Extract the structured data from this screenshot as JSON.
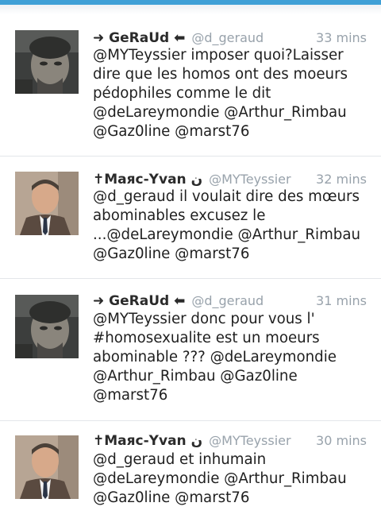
{
  "users": {
    "geraud": {
      "display_name": "➜ GeRaUd ⬅",
      "handle": "@d_geraud",
      "avatar_icon": "dark-selfie-avatar"
    },
    "yvan": {
      "display_name": "✝Маяс-Yvan ن",
      "handle": "@MYTeyssier",
      "avatar_icon": "man-in-suit-avatar"
    }
  },
  "tweets": [
    {
      "display_name": "➜ GeRaUd ⬅",
      "handle": "@d_geraud",
      "time": "33 mins",
      "lines": [
        "@MYTeyssier imposer quoi?Laisser",
        "dire que les homos ont des moeurs",
        "pédophiles comme le dit",
        "@deLareymondie @Arthur_Rimbau",
        "@Gaz0line @marst76"
      ]
    },
    {
      "display_name": "✝Маяс-Yvan ن",
      "handle": "@MYTeyssier",
      "time": "32 mins",
      "lines": [
        "@d_geraud il voulait dire des mœurs",
        "abominables excusez le",
        "...@deLareymondie @Arthur_Rimbau",
        "@Gaz0line @marst76"
      ]
    },
    {
      "display_name": "➜ GeRaUd ⬅",
      "handle": "@d_geraud",
      "time": "31 mins",
      "lines": [
        "@MYTeyssier donc pour vous l'",
        "#homosexualite est un moeurs",
        "abominable ??? @deLareymondie",
        "@Arthur_Rimbau @Gaz0line",
        "@marst76"
      ]
    },
    {
      "display_name": "✝Маяс-Yvan ن",
      "handle": "@MYTeyssier",
      "time": "30 mins",
      "lines": [
        "@d_geraud et inhumain",
        "@deLareymondie @Arthur_Rimbau",
        "@Gaz0line @marst76"
      ]
    }
  ]
}
